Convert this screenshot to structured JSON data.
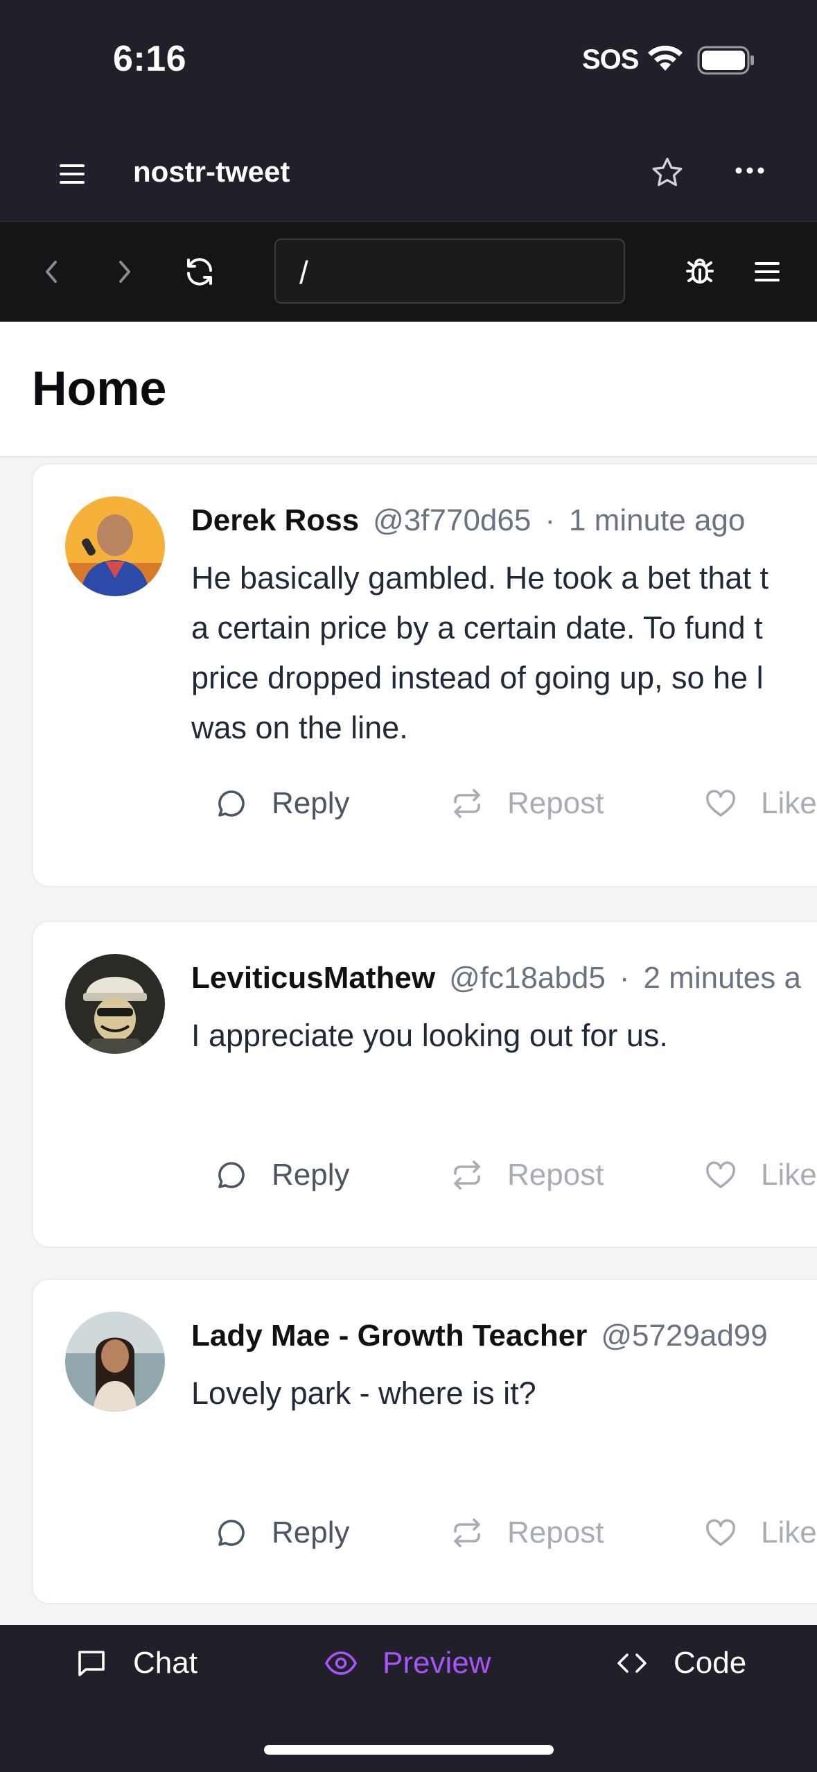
{
  "status": {
    "time": "6:16",
    "sos": "SOS"
  },
  "app": {
    "title": "nostr-tweet"
  },
  "browser": {
    "url": "/"
  },
  "page": {
    "title": "Home"
  },
  "posts": [
    {
      "name": "Derek Ross",
      "handle": "@3f770d65",
      "separator": "·",
      "time": "1 minute ago",
      "lines": [
        "He basically gambled. He took a bet that t",
        "a certain price by a certain date. To fund t",
        "price dropped instead of going up, so he l",
        "was on the line."
      ],
      "actions": {
        "reply": "Reply",
        "repost": "Repost",
        "like": "Like"
      }
    },
    {
      "name": "LeviticusMathew",
      "handle": "@fc18abd5",
      "separator": "·",
      "time": "2 minutes a",
      "lines": [
        "I appreciate you looking out for us."
      ],
      "actions": {
        "reply": "Reply",
        "repost": "Repost",
        "like": "Like"
      }
    },
    {
      "name": "Lady Mae - Growth Teacher",
      "handle": "@5729ad99",
      "separator": "",
      "time": "",
      "lines": [
        "Lovely park - where is it?"
      ],
      "actions": {
        "reply": "Reply",
        "repost": "Repost",
        "like": "Like"
      }
    }
  ],
  "nav": {
    "chat": "Chat",
    "preview": "Preview",
    "code": "Code"
  },
  "colors": {
    "header": "#211f29",
    "toolbar": "#151517",
    "accent": "#a855f7"
  }
}
